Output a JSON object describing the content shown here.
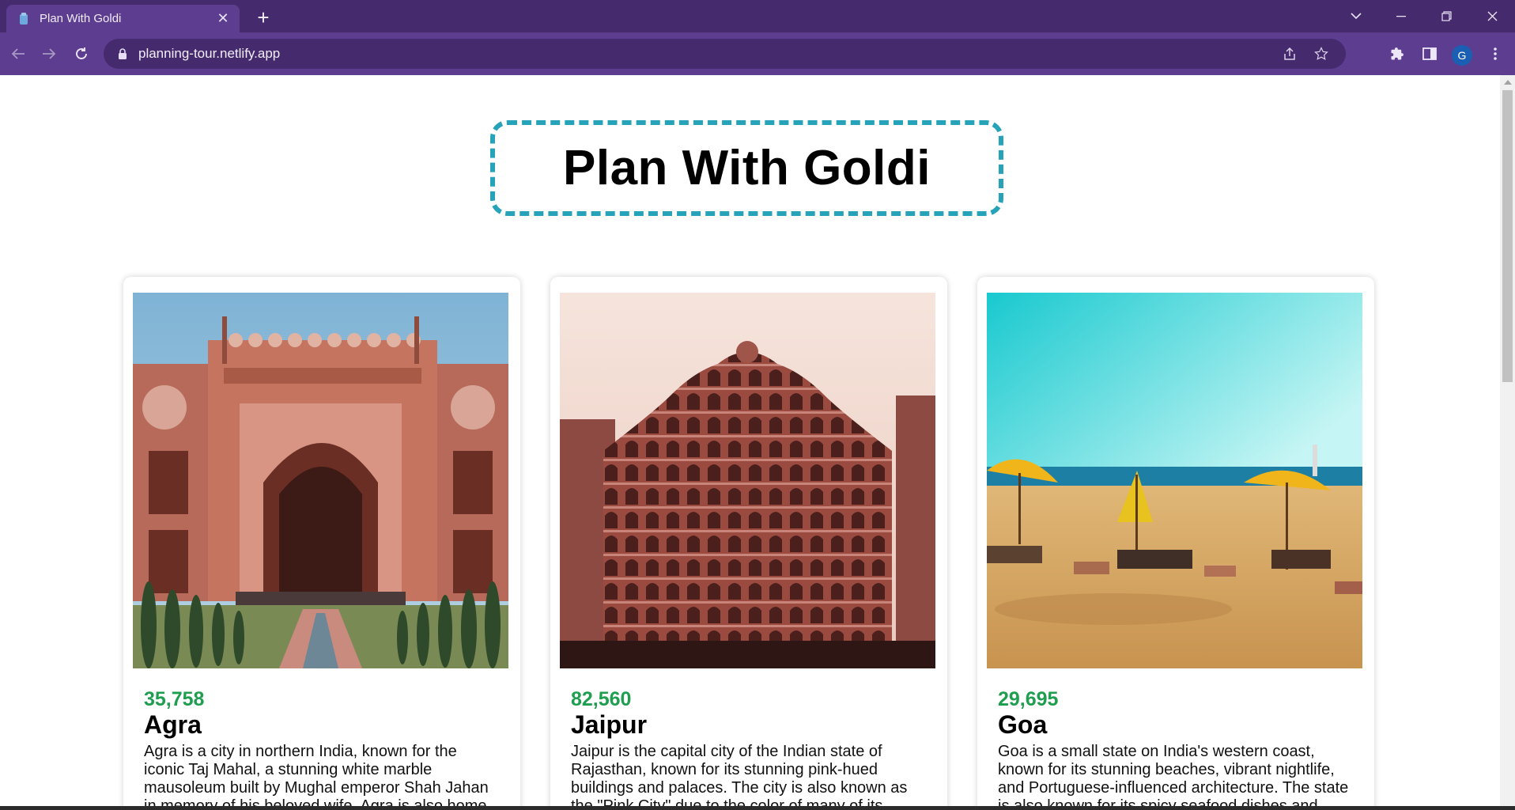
{
  "browser": {
    "tab_title": "Plan With Goldi",
    "url": "planning-tour.netlify.app",
    "profile_initial": "G",
    "colors": {
      "frame": "#452a6d",
      "toolbar": "#5c3d8f"
    }
  },
  "page": {
    "heading": "Plan With Goldi",
    "accent_border_color": "#26a3b8",
    "price_color": "#1f9e4f",
    "tours": [
      {
        "price": "35,758",
        "name": "Agra",
        "image_icon": "taj-mahal-gate-photo",
        "description": "Agra is a city in northern India, known for the iconic Taj Mahal, a stunning white marble mausoleum built by Mughal emperor Shah Jahan in memory of his beloved wife. Agra is also home"
      },
      {
        "price": "82,560",
        "name": "Jaipur",
        "image_icon": "hawa-mahal-photo",
        "description": "Jaipur is the capital city of the Indian state of Rajasthan, known for its stunning pink-hued buildings and palaces. The city is also known as the \"Pink City\" due to the color of many of its"
      },
      {
        "price": "29,695",
        "name": "Goa",
        "image_icon": "goa-beach-photo",
        "description": "Goa is a small state on India's western coast, known for its stunning beaches, vibrant nightlife, and Portuguese-influenced architecture. The state is also known for its spicy seafood dishes and"
      }
    ]
  }
}
